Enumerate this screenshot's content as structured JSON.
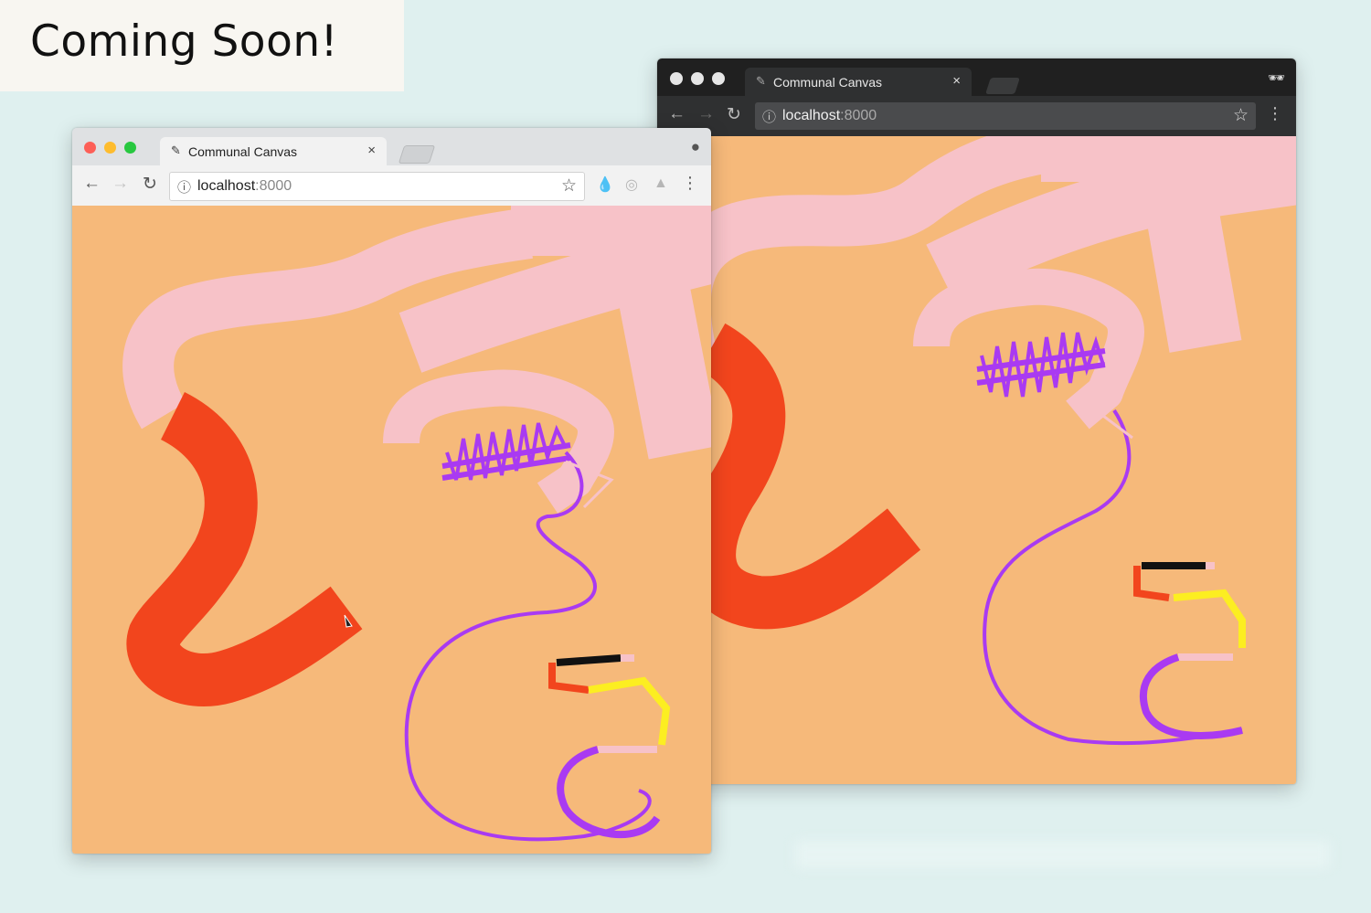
{
  "banner": {
    "text": "Coming Soon!"
  },
  "windows": {
    "light": {
      "tab_title": "Communal Canvas",
      "url_host": "localhost",
      "url_port": ":8000"
    },
    "dark": {
      "tab_title": "Communal Canvas",
      "url_host": "localhost",
      "url_port": ":8000"
    }
  },
  "icons": {
    "favicon": "paint-brush-icon",
    "close": "close-icon",
    "back": "back-arrow-icon",
    "forward": "forward-arrow-icon",
    "reload": "reload-icon",
    "info": "info-icon",
    "bookmark": "star-icon",
    "profile": "profile-icon",
    "incognito": "incognito-icon",
    "menu": "kebab-menu-icon"
  },
  "colors": {
    "canvas_bg": "#f6b97a",
    "pink": "#f7c2c8",
    "red_orange": "#f2451d",
    "purple": "#a93af2",
    "yellow": "#fcee21",
    "black": "#111111",
    "page_bg": "#dff0ef"
  }
}
